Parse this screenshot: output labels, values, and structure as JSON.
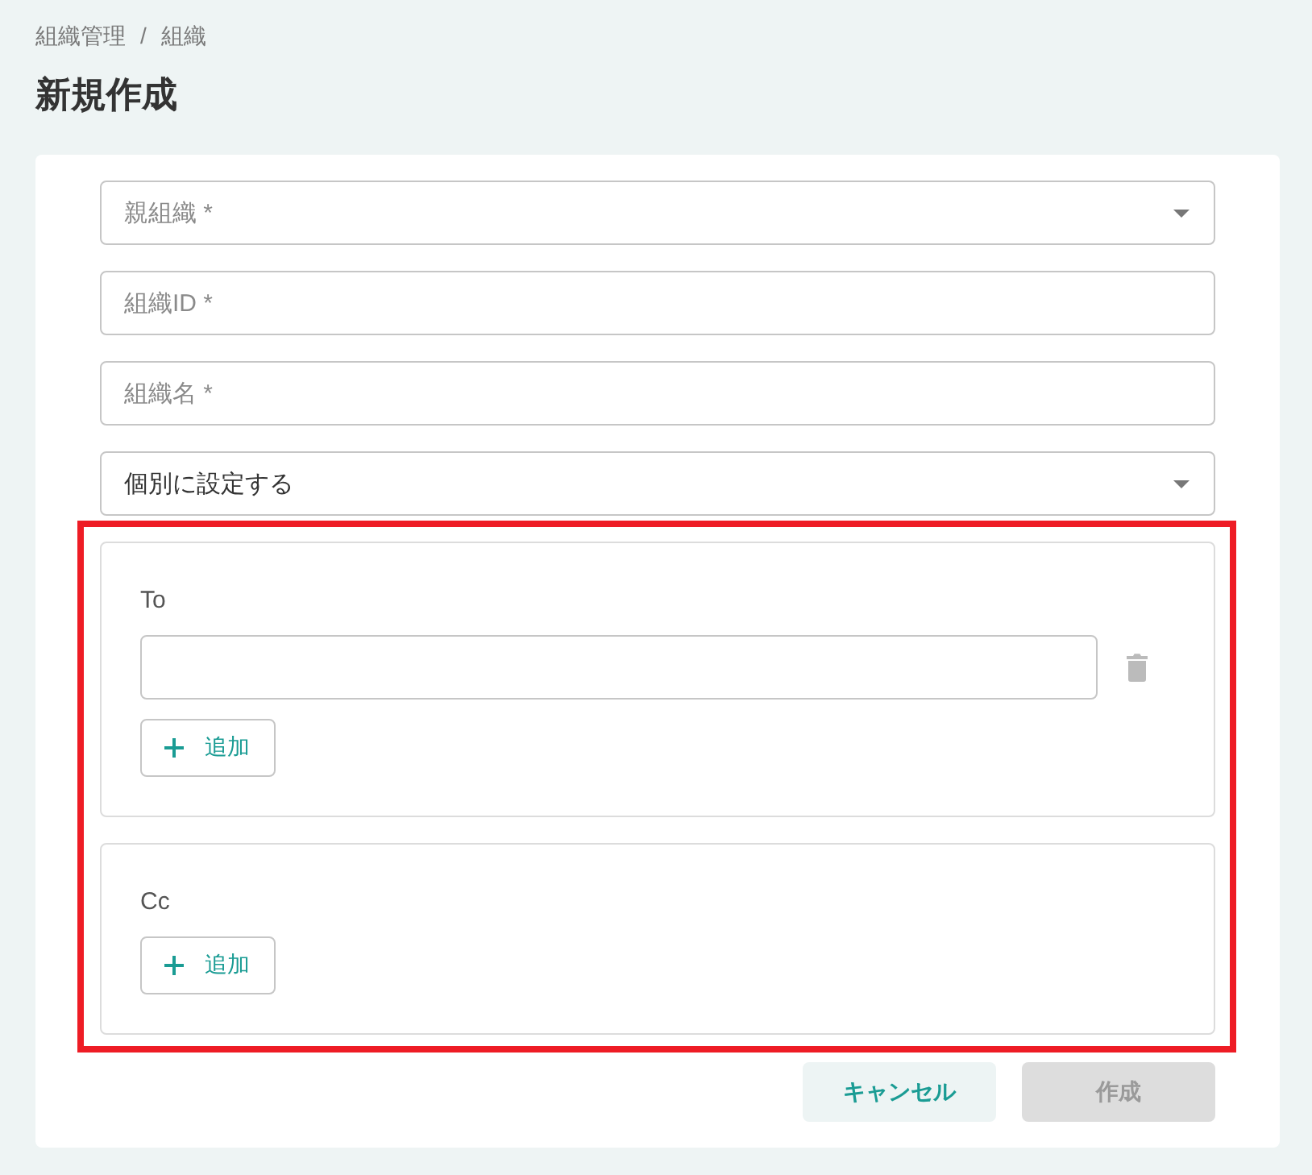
{
  "breadcrumb": {
    "items": [
      "組織管理",
      "組織"
    ],
    "separator": "/"
  },
  "title": "新規作成",
  "fields": [
    {
      "kind": "select",
      "placeholder": "親組織 *"
    },
    {
      "kind": "text",
      "placeholder": "組織ID *"
    },
    {
      "kind": "text",
      "placeholder": "組織名 *"
    },
    {
      "kind": "select",
      "value": "個別に設定する"
    }
  ],
  "recipients": {
    "highlighted": true,
    "groups": [
      {
        "label": "To",
        "entries": [
          {
            "deletable": true
          }
        ],
        "add_button": "追加"
      },
      {
        "label": "Cc",
        "add_button": "追加"
      }
    ]
  },
  "actions": [
    {
      "label": "キャンセル",
      "kind": "secondary",
      "disabled": false
    },
    {
      "label": "作成",
      "kind": "primary",
      "disabled": true
    }
  ]
}
